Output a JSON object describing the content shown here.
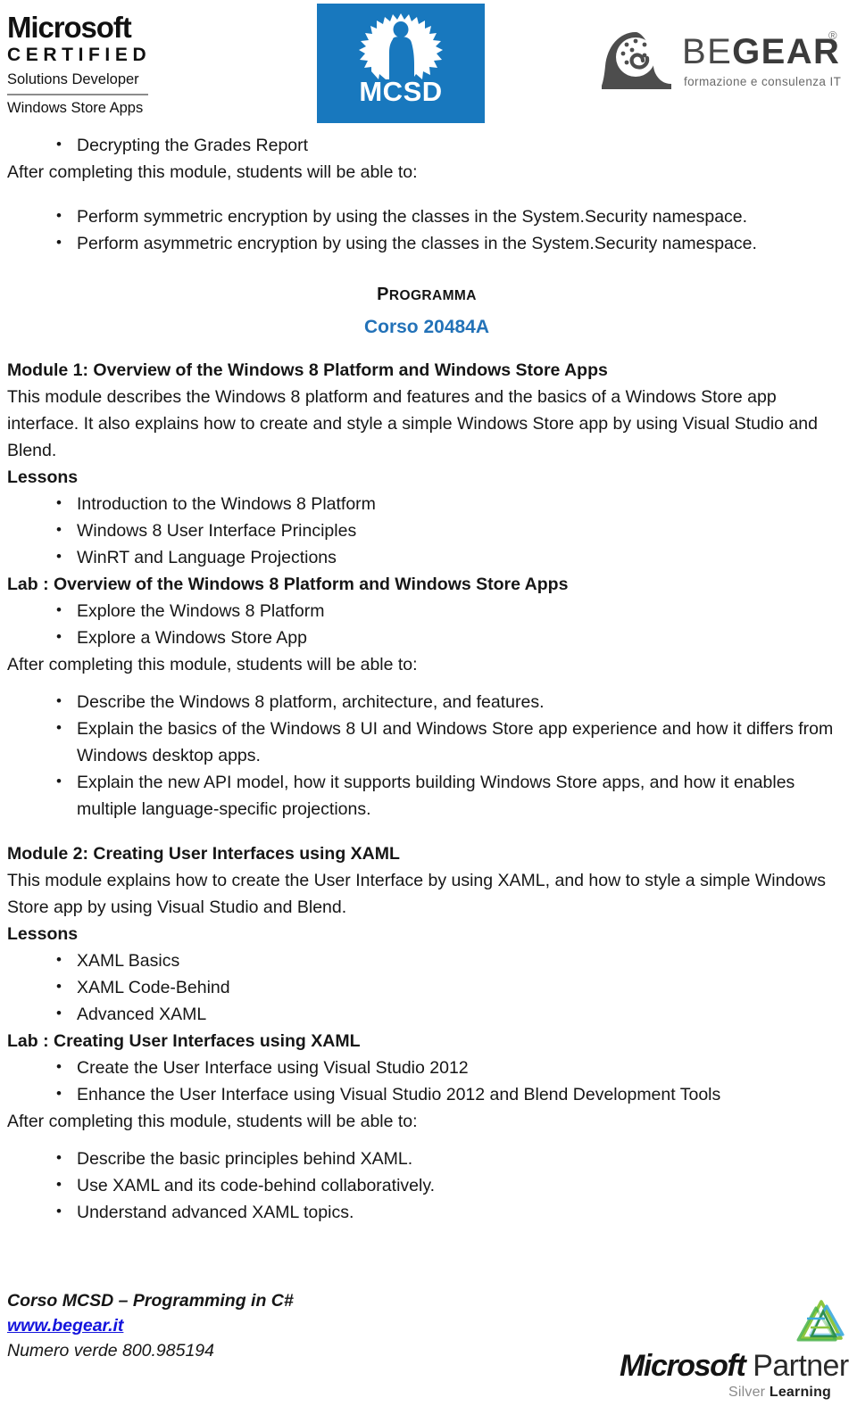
{
  "header": {
    "ms_certified": {
      "line1": "Microsoft",
      "line2": "CERTIFIED",
      "line3": "Solutions Developer",
      "line4": "Windows Store Apps"
    },
    "mcsd_badge": {
      "label": "MCSD",
      "color": "#1878be"
    },
    "begear": {
      "word_light": "BE",
      "word_bold": "GEAR",
      "registered": "®",
      "tagline": "formazione e consulenza IT"
    }
  },
  "top_section": {
    "bullet_first": "Decrypting the Grades Report",
    "after_line": "After completing this module, students will be able to:",
    "objectives": [
      "Perform symmetric encryption by using the classes in the System.Security namespace.",
      "Perform asymmetric encryption by using the classes in the System.Security namespace."
    ]
  },
  "programma": {
    "title_first": "P",
    "title_rest": "ROGRAMMA",
    "corso": "Corso 20484A",
    "corso_color": "#2372b8"
  },
  "modules": [
    {
      "heading": "Module 1: Overview of the Windows 8 Platform and Windows Store Apps",
      "description": "This module describes the Windows 8 platform and features and the basics of a Windows Store app interface. It also explains how to create and style a simple Windows Store app by using Visual Studio and Blend.",
      "lessons_label": "Lessons",
      "lessons": [
        "Introduction to the Windows 8 Platform",
        "Windows 8 User Interface Principles",
        "WinRT and Language Projections"
      ],
      "lab_label": "Lab : Overview of the Windows 8 Platform and Windows Store Apps",
      "lab_items": [
        "Explore the Windows 8 Platform",
        "Explore a Windows Store App"
      ],
      "after_line": "After completing this module, students will be able to:",
      "objectives": [
        "Describe the Windows 8 platform, architecture, and features.",
        "Explain the basics of the Windows 8 UI and Windows Store app experience and how it differs from Windows desktop apps.",
        "Explain the new API model, how it supports building Windows Store apps, and how it enables multiple language-specific projections."
      ]
    },
    {
      "heading": "Module 2: Creating User Interfaces using XAML",
      "description": "This module explains how to create the User Interface by using XAML, and how to style a simple Windows Store app by using Visual Studio and Blend.",
      "lessons_label": "Lessons",
      "lessons": [
        "XAML Basics",
        "XAML Code-Behind",
        "Advanced XAML"
      ],
      "lab_label": "Lab : Creating User Interfaces using XAML",
      "lab_items": [
        "Create the User Interface using Visual Studio 2012",
        "Enhance the User Interface using Visual Studio 2012 and Blend Development Tools"
      ],
      "after_line": "After completing this module, students will be able to:",
      "objectives": [
        "Describe the basic principles behind XAML.",
        "Use XAML and its code-behind collaboratively.",
        "Understand advanced XAML topics."
      ]
    }
  ],
  "footer": {
    "course_line": "Corso MCSD – Programming in C#",
    "website": "www.begear.it",
    "website_color": "#1414dd",
    "phone": "Numero verde 800.985194",
    "partner": {
      "microsoft": "Microsoft",
      "partner": " Partner",
      "silver": "Silver ",
      "learning": "Learning"
    }
  }
}
